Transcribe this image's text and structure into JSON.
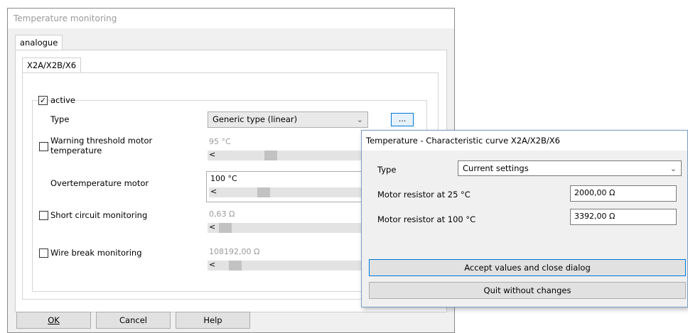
{
  "main_window": {
    "title": "Temperature monitoring",
    "tab_outer": "analogue",
    "tab_inner": "X2A/X2B/X6",
    "active_label": "active",
    "active_check": "✓",
    "type_label": "Type",
    "type_value": "Generic type (linear)",
    "dots_label": "...",
    "rows": [
      {
        "label": "Warning threshold motor temperature",
        "value": "95 °C",
        "enabled": false
      },
      {
        "label": "Overtemperature motor",
        "value": "100 °C",
        "enabled": true
      },
      {
        "label": "Short circuit monitoring",
        "value": "0,63 Ω",
        "enabled": false
      },
      {
        "label": "Wire break monitoring",
        "value": "108192,00 Ω",
        "enabled": false
      }
    ],
    "buttons": {
      "ok": "OK",
      "cancel": "Cancel",
      "help": "Help"
    }
  },
  "dialog": {
    "title": "Temperature - Characteristic curve X2A/X2B/X6",
    "type_label": "Type",
    "type_value": "Current settings",
    "r25_label": "Motor resistor at 25  °C",
    "r25_value": "2000,00 Ω",
    "r100_label": "Motor resistor at 100  °C",
    "r100_value": "3392,00 Ω",
    "accept_label": "Accept values and close dialog",
    "quit_label": "Quit without changes"
  },
  "colors": {
    "focus_border": "#0078d7",
    "dialog_border": "#7a9cc6"
  }
}
